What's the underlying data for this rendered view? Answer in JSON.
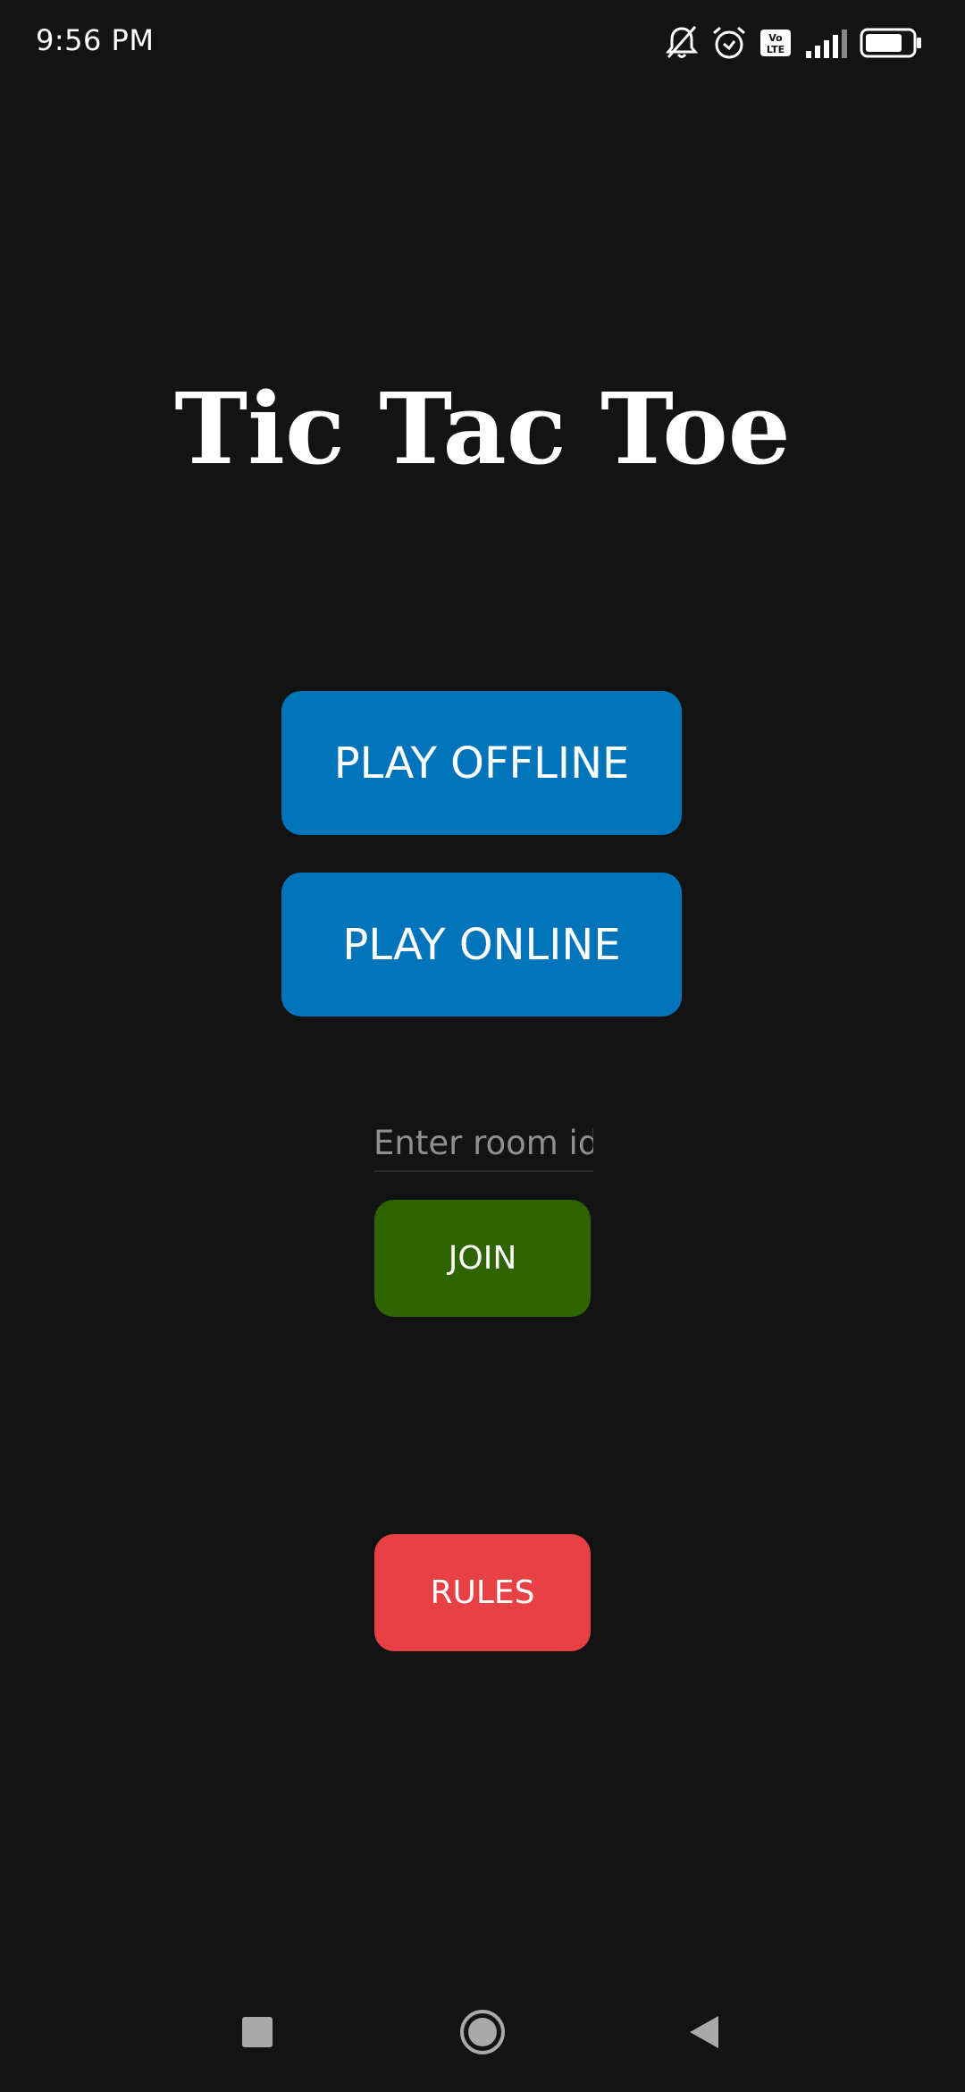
{
  "status_bar": {
    "time": "9:56 PM",
    "icons": [
      "bell-off-icon",
      "alarm-icon",
      "volte-icon",
      "signal-icon",
      "battery-icon"
    ],
    "volte_label_top": "Vo",
    "volte_label_bottom": "LTE",
    "battery_level": 0.8
  },
  "app": {
    "title": "Tic Tac Toe"
  },
  "buttons": {
    "play_offline": "PLAY OFFLINE",
    "play_online": "PLAY ONLINE",
    "join": "JOIN",
    "rules": "RULES"
  },
  "room": {
    "placeholder": "Enter room id",
    "value": ""
  },
  "nav": {
    "icons": [
      "recents-icon",
      "home-icon",
      "back-icon"
    ]
  },
  "colors": {
    "background": "#131313",
    "primary_button": "#0074BA",
    "join_button": "#2F6500",
    "rules_button": "#E84145",
    "placeholder": "#8F8F8F"
  }
}
